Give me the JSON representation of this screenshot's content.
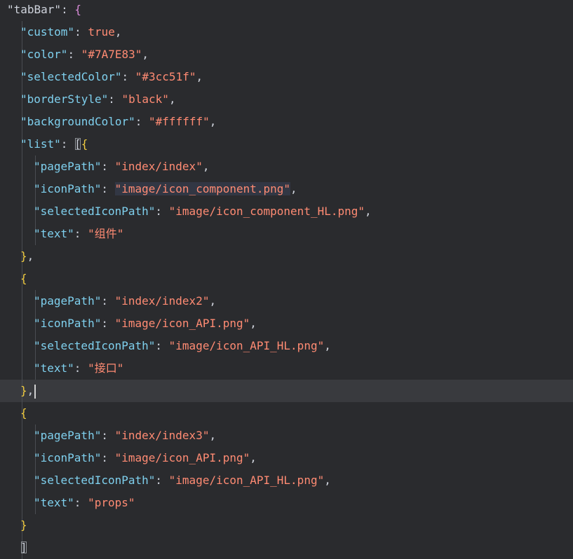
{
  "editor": {
    "lines": [
      {
        "indent": 0,
        "tokens": [
          {
            "t": "\"tabBar\"",
            "c": "punc"
          },
          {
            "t": ": ",
            "c": "punc"
          },
          {
            "t": "{",
            "c": "brace-outer"
          }
        ]
      },
      {
        "indent": 1,
        "tokens": [
          {
            "t": "\"custom\"",
            "c": "key"
          },
          {
            "t": ": ",
            "c": "punc"
          },
          {
            "t": "true",
            "c": "bool"
          },
          {
            "t": ",",
            "c": "punc"
          }
        ]
      },
      {
        "indent": 1,
        "tokens": [
          {
            "t": "\"color\"",
            "c": "key"
          },
          {
            "t": ": ",
            "c": "punc"
          },
          {
            "t": "\"#7A7E83\"",
            "c": "str"
          },
          {
            "t": ",",
            "c": "punc"
          }
        ]
      },
      {
        "indent": 1,
        "tokens": [
          {
            "t": "\"selectedColor\"",
            "c": "key"
          },
          {
            "t": ": ",
            "c": "punc"
          },
          {
            "t": "\"#3cc51f\"",
            "c": "str"
          },
          {
            "t": ",",
            "c": "punc"
          }
        ]
      },
      {
        "indent": 1,
        "tokens": [
          {
            "t": "\"borderStyle\"",
            "c": "key"
          },
          {
            "t": ": ",
            "c": "punc"
          },
          {
            "t": "\"black\"",
            "c": "str"
          },
          {
            "t": ",",
            "c": "punc"
          }
        ]
      },
      {
        "indent": 1,
        "tokens": [
          {
            "t": "\"backgroundColor\"",
            "c": "key"
          },
          {
            "t": ": ",
            "c": "punc"
          },
          {
            "t": "\"#ffffff\"",
            "c": "str"
          },
          {
            "t": ",",
            "c": "punc"
          }
        ]
      },
      {
        "indent": 1,
        "tokens": [
          {
            "t": "\"list\"",
            "c": "key"
          },
          {
            "t": ": ",
            "c": "punc"
          },
          {
            "t": "[",
            "c": "punc",
            "match": true
          },
          {
            "t": "{",
            "c": "brace-inner"
          }
        ]
      },
      {
        "indent": 2,
        "tokens": [
          {
            "t": "\"pagePath\"",
            "c": "key"
          },
          {
            "t": ": ",
            "c": "punc"
          },
          {
            "t": "\"index/index\"",
            "c": "str"
          },
          {
            "t": ",",
            "c": "punc"
          }
        ]
      },
      {
        "indent": 2,
        "tokens": [
          {
            "t": "\"iconPath\"",
            "c": "key"
          },
          {
            "t": ": ",
            "c": "punc"
          },
          {
            "t": "\"image/icon_component.png\"",
            "c": "str",
            "hl": true
          },
          {
            "t": ",",
            "c": "punc"
          }
        ]
      },
      {
        "indent": 2,
        "tokens": [
          {
            "t": "\"selectedIconPath\"",
            "c": "key"
          },
          {
            "t": ": ",
            "c": "punc"
          },
          {
            "t": "\"image/icon_component_HL.png\"",
            "c": "str"
          },
          {
            "t": ",",
            "c": "punc"
          }
        ]
      },
      {
        "indent": 2,
        "tokens": [
          {
            "t": "\"text\"",
            "c": "key"
          },
          {
            "t": ": ",
            "c": "punc"
          },
          {
            "t": "\"组件\"",
            "c": "str"
          }
        ]
      },
      {
        "indent": 1,
        "extraGuideOff": true,
        "tokens": [
          {
            "t": "}",
            "c": "brace-inner"
          },
          {
            "t": ",",
            "c": "punc"
          }
        ]
      },
      {
        "indent": 1,
        "extraGuideOff": true,
        "tokens": [
          {
            "t": "{",
            "c": "brace-inner"
          }
        ]
      },
      {
        "indent": 2,
        "tokens": [
          {
            "t": "\"pagePath\"",
            "c": "key"
          },
          {
            "t": ": ",
            "c": "punc"
          },
          {
            "t": "\"index/index2\"",
            "c": "str"
          },
          {
            "t": ",",
            "c": "punc"
          }
        ]
      },
      {
        "indent": 2,
        "tokens": [
          {
            "t": "\"iconPath\"",
            "c": "key"
          },
          {
            "t": ": ",
            "c": "punc"
          },
          {
            "t": "\"image/icon_API.png\"",
            "c": "str"
          },
          {
            "t": ",",
            "c": "punc"
          }
        ]
      },
      {
        "indent": 2,
        "tokens": [
          {
            "t": "\"selectedIconPath\"",
            "c": "key"
          },
          {
            "t": ": ",
            "c": "punc"
          },
          {
            "t": "\"image/icon_API_HL.png\"",
            "c": "str"
          },
          {
            "t": ",",
            "c": "punc"
          }
        ]
      },
      {
        "indent": 2,
        "tokens": [
          {
            "t": "\"text\"",
            "c": "key"
          },
          {
            "t": ": ",
            "c": "punc"
          },
          {
            "t": "\"接口\"",
            "c": "str"
          }
        ]
      },
      {
        "indent": 1,
        "current": true,
        "cursor": true,
        "tokens": [
          {
            "t": "}",
            "c": "brace-inner"
          },
          {
            "t": ",",
            "c": "punc"
          }
        ]
      },
      {
        "indent": 1,
        "tokens": [
          {
            "t": "{",
            "c": "brace-inner"
          }
        ]
      },
      {
        "indent": 2,
        "tokens": [
          {
            "t": "\"pagePath\"",
            "c": "key"
          },
          {
            "t": ": ",
            "c": "punc"
          },
          {
            "t": "\"index/index3\"",
            "c": "str"
          },
          {
            "t": ",",
            "c": "punc"
          }
        ]
      },
      {
        "indent": 2,
        "tokens": [
          {
            "t": "\"iconPath\"",
            "c": "key"
          },
          {
            "t": ": ",
            "c": "punc"
          },
          {
            "t": "\"image/icon_API.png\"",
            "c": "str"
          },
          {
            "t": ",",
            "c": "punc"
          }
        ]
      },
      {
        "indent": 2,
        "tokens": [
          {
            "t": "\"selectedIconPath\"",
            "c": "key"
          },
          {
            "t": ": ",
            "c": "punc"
          },
          {
            "t": "\"image/icon_API_HL.png\"",
            "c": "str"
          },
          {
            "t": ",",
            "c": "punc"
          }
        ]
      },
      {
        "indent": 2,
        "tokens": [
          {
            "t": "\"text\"",
            "c": "key"
          },
          {
            "t": ": ",
            "c": "punc"
          },
          {
            "t": "\"props\"",
            "c": "str"
          }
        ]
      },
      {
        "indent": 1,
        "tokens": [
          {
            "t": "}",
            "c": "brace-inner"
          }
        ]
      },
      {
        "indent": 1,
        "tokens": [
          {
            "t": "]",
            "c": "punc",
            "match": true
          }
        ]
      }
    ]
  }
}
